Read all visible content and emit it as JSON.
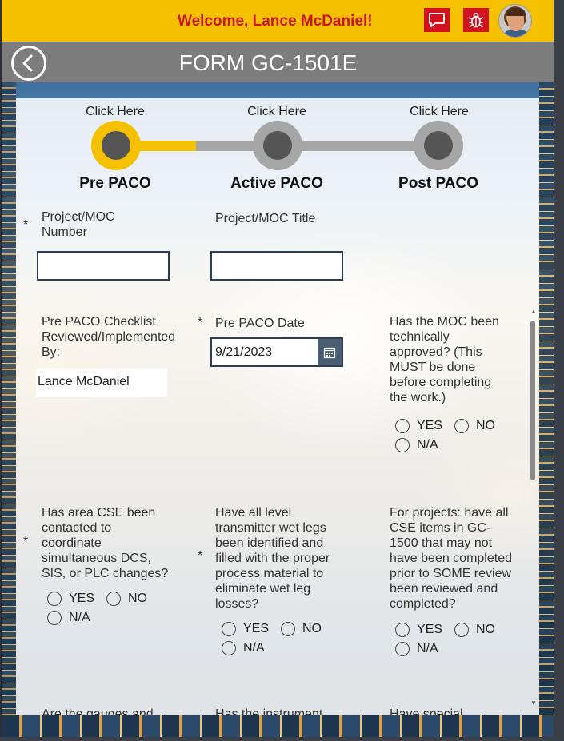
{
  "header": {
    "welcome": "Welcome, Lance McDaniel!",
    "brand_color": "#f5c000",
    "accent_color": "#d3121f",
    "icons": [
      "chat-icon",
      "bug-icon"
    ]
  },
  "titlebar": {
    "title": "FORM GC-1501E",
    "back_icon": "chevron-left-icon"
  },
  "stepper": {
    "steps": [
      {
        "click": "Click Here",
        "label": "Pre PACO",
        "active": true
      },
      {
        "click": "Click Here",
        "label": "Active PACO",
        "active": false
      },
      {
        "click": "Click Here",
        "label": "Post PACO",
        "active": false
      }
    ]
  },
  "fields": {
    "project_number": {
      "label": "Project/MOC Number",
      "value": "",
      "required": "*"
    },
    "project_title": {
      "label": "Project/MOC Title",
      "value": ""
    },
    "reviewed_by": {
      "label": "Pre PACO Checklist Reviewed/Implemented By:",
      "value": "Lance McDaniel"
    },
    "pre_paco_date": {
      "label": "Pre PACO Date",
      "value": "9/21/2023",
      "required": "*"
    },
    "moc_approved": {
      "label": "Has the MOC been technically approved? (This MUST be done before completing the work.)"
    },
    "area_cse": {
      "label": "Has area CSE been contacted to coordinate simultaneous DCS, SIS, or PLC changes?",
      "required": "*"
    },
    "wet_legs": {
      "label": "Have all level transmitter wet legs been identified and filled with the proper process material to eliminate wet leg losses?",
      "required": "*"
    },
    "cse_items": {
      "label": "For projects: have all CSE items in GC-1500 that may not have been completed prior to SOME review been reviewed and completed?"
    },
    "gauges": {
      "label": "Are the gauges and"
    },
    "instrument": {
      "label": "Has the instrument"
    },
    "special": {
      "label": "Have special"
    }
  },
  "radio_options": {
    "yes": "YES",
    "no": "NO",
    "na": "N/A"
  }
}
